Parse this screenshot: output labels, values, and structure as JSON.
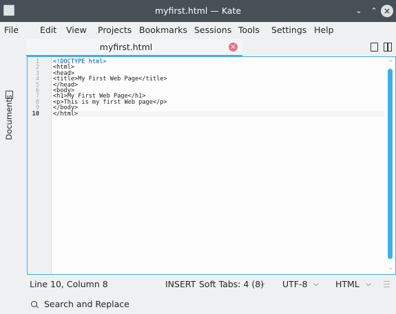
{
  "window": {
    "title": "myfirst.html — Kate"
  },
  "menu": [
    "File",
    "Edit",
    "View",
    "Projects",
    "Bookmarks",
    "Sessions",
    "Tools",
    "Settings",
    "Help"
  ],
  "sidebar": {
    "label": "Documents"
  },
  "tabs": [
    {
      "label": "myfirst.html"
    }
  ],
  "editor": {
    "line_numbers": [
      "1",
      "2",
      "3",
      "4",
      "5",
      "6",
      "7",
      "8",
      "9",
      "10"
    ],
    "lines": [
      "<!DOCTYPE html>",
      "<html>",
      "<head>",
      "<title>My First Web Page</title>",
      "</head>",
      "<body>",
      "<h1>My First Web Page</h1>",
      "<p>This is my first Web page</p>",
      "</body>",
      "</html>"
    ],
    "current_line": 10
  },
  "status": {
    "position": "Line 10, Column 8",
    "mode": "INSERT",
    "indent": "Soft Tabs: 4 (8)",
    "encoding": "UTF-8",
    "syntax": "HTML"
  },
  "bottom": {
    "search_label": "Search and Replace"
  },
  "colors": {
    "accent": "#3daee9",
    "titlebar": "#475057",
    "tab_close": "#e2748b"
  }
}
